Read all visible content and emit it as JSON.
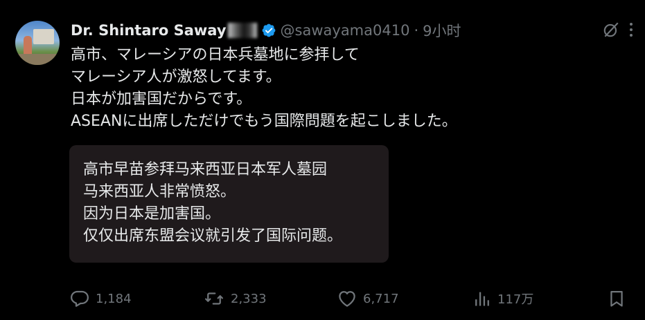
{
  "author": {
    "name": "Dr. Shintaro Saway",
    "handle": "@sawayama0410",
    "separator": "·",
    "time": "9小时"
  },
  "post": {
    "lines": [
      "高市、マレーシアの日本兵墓地に参拝して",
      "マレーシア人が激怒してます。",
      "日本が加害国だからです。",
      "ASEANに出席しただけでもう国際問題を起こしました。"
    ]
  },
  "translation": {
    "lines": [
      "高市早苗参拜马来西亚日本军人墓园",
      "马来西亚人非常愤怒。",
      "因为日本是加害国。",
      "仅仅出席东盟会议就引发了国际问题。"
    ]
  },
  "actions": {
    "replies": "1,184",
    "reposts": "2,333",
    "likes": "6,717",
    "views": "117万"
  },
  "icons": {
    "verified": "verified-badge-icon",
    "grok": "grok-icon",
    "more": "more-icon",
    "reply": "reply-icon",
    "repost": "repost-icon",
    "like": "heart-icon",
    "views": "views-chart-icon",
    "bookmark": "bookmark-icon"
  },
  "colors": {
    "background": "#000000",
    "text": "#e7e9ea",
    "muted": "#71767b",
    "verified": "#1d9bf0",
    "quote_bg": "#1f1a1c"
  }
}
